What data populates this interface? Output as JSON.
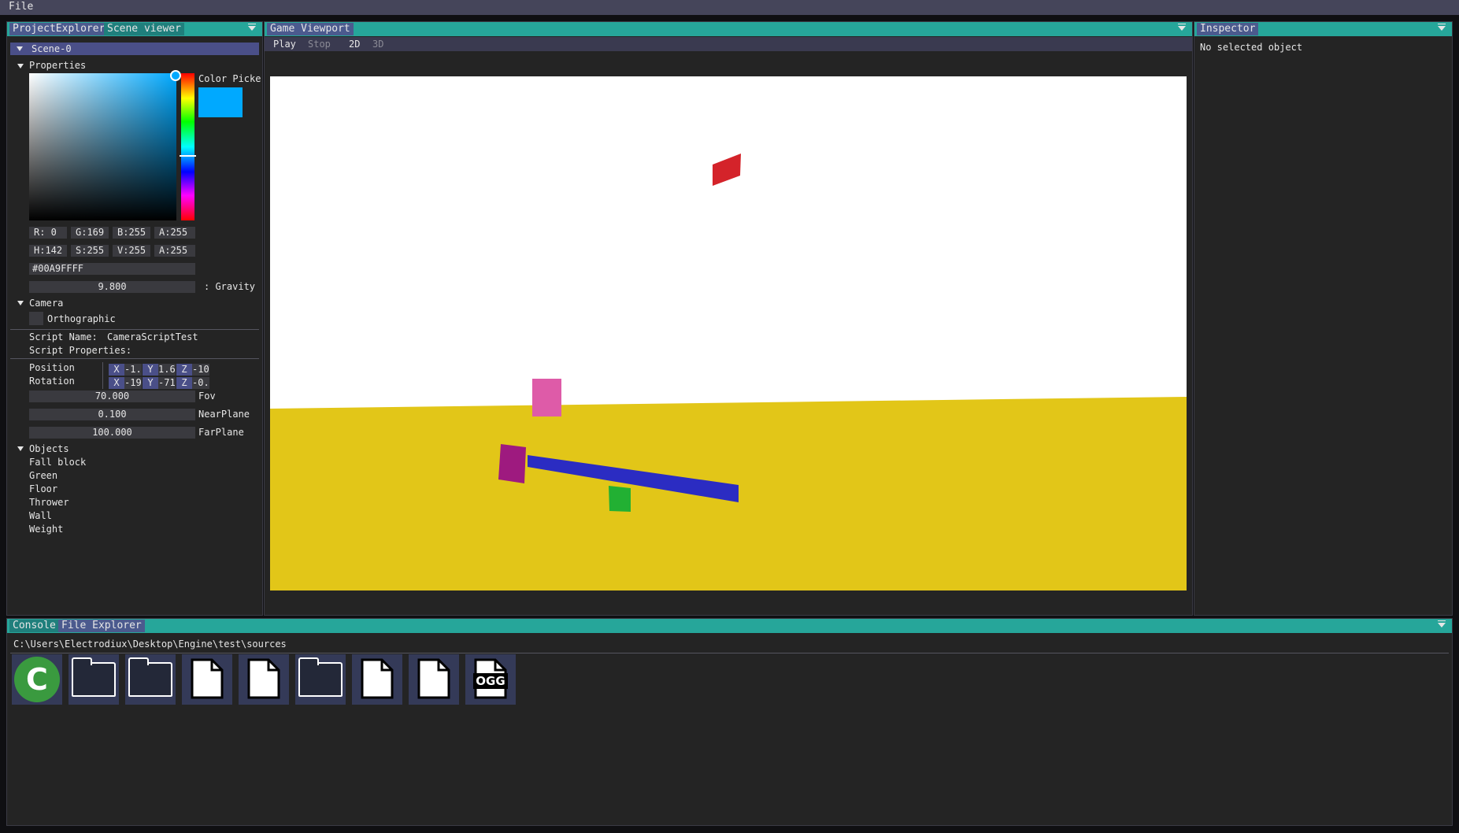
{
  "menu": {
    "file": "File"
  },
  "left_panel": {
    "tabs": [
      "ProjectExplorer",
      "Scene viewer"
    ],
    "scene_node": "Scene-0",
    "properties_header": "Properties",
    "color_picker": {
      "label": "Color Picke",
      "r": "R:  0",
      "g": "G:169",
      "b": "B:255",
      "a": "A:255",
      "h": "H:142",
      "s": "S:255",
      "v": "V:255",
      "a2": "A:255",
      "hex": "#00A9FFFF",
      "swatch_color": "#00a9ff"
    },
    "gravity": {
      "value": "9.800",
      "label": ": Gravity"
    },
    "camera": {
      "header": "Camera",
      "orthographic_label": "Orthographic",
      "script_name_label": "Script Name:",
      "script_name_value": "CameraScriptTest",
      "script_properties_label": "Script Properties:",
      "position_label": "Position",
      "rotation_label": "Rotation",
      "position": {
        "x_label": "X",
        "x": "-1.",
        "y_label": "Y",
        "y": "1.6",
        "z_label": "Z",
        "z": "-10"
      },
      "rotation": {
        "x_label": "X",
        "x": "-19",
        "y_label": "Y",
        "y": "-71",
        "z_label": "Z",
        "z": "-0."
      },
      "fov_value": "70.000",
      "fov_label": "Fov",
      "near_value": "0.100",
      "near_label": "NearPlane",
      "far_value": "100.000",
      "far_label": "FarPlane"
    },
    "objects": {
      "header": "Objects",
      "items": [
        "Fall block",
        "Green",
        "Floor",
        "Thrower",
        "Wall",
        "Weight"
      ]
    }
  },
  "viewport": {
    "tab": "Game Viewport",
    "toolbar": {
      "play": "Play",
      "stop": "Stop",
      "mode2d": "2D",
      "mode3d": "3D"
    },
    "colors": {
      "sky": "#ffffff",
      "floor": "#e2c618",
      "red": "#d4232a",
      "pink": "#de5ba8",
      "purple": "#9e1a7f",
      "blue": "#2b2cc2",
      "green": "#22b033"
    }
  },
  "inspector": {
    "tab": "Inspector",
    "empty_text": "No selected object"
  },
  "bottom_panel": {
    "tabs": [
      "Console",
      "File Explorer"
    ],
    "path": "C:\\Users\\Electrodiux\\Desktop\\Engine\\test\\sources",
    "files": [
      {
        "icon": "c-source-file-icon",
        "text": "C"
      },
      {
        "icon": "folder-icon"
      },
      {
        "icon": "folder-icon"
      },
      {
        "icon": "document-icon"
      },
      {
        "icon": "document-icon"
      },
      {
        "icon": "folder-icon"
      },
      {
        "icon": "document-icon"
      },
      {
        "icon": "document-icon"
      },
      {
        "icon": "ogg-audio-icon",
        "text": "OGG"
      }
    ]
  }
}
